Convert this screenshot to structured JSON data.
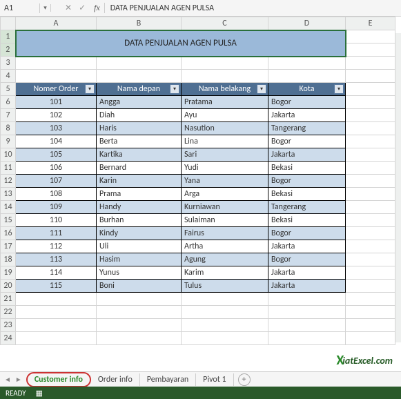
{
  "formula_bar": {
    "name_box": "A1",
    "cancel": "✕",
    "enter": "✓",
    "fx": "fx",
    "formula": "DATA PENJUALAN AGEN PULSA"
  },
  "columns": [
    "A",
    "B",
    "C",
    "D",
    "E"
  ],
  "row_numbers": [
    "1",
    "2",
    "3",
    "4",
    "5",
    "6",
    "7",
    "8",
    "9",
    "10",
    "11",
    "12",
    "13",
    "14",
    "15",
    "16",
    "17",
    "18",
    "19",
    "20",
    "21",
    "22",
    "23",
    "24"
  ],
  "title_cell": "DATA PENJUALAN AGEN PULSA",
  "chart_data": {
    "type": "table",
    "headers": [
      "Nomer Order",
      "Nama depan",
      "Nama belakang",
      "Kota"
    ],
    "rows": [
      [
        "101",
        "Angga",
        "Pratama",
        "Bogor"
      ],
      [
        "102",
        "Diah",
        "Ayu",
        "Jakarta"
      ],
      [
        "103",
        "Haris",
        "Nasution",
        "Tangerang"
      ],
      [
        "104",
        "Berta",
        "Lina",
        "Bogor"
      ],
      [
        "105",
        "Kartika",
        "Sari",
        "Jakarta"
      ],
      [
        "106",
        "Bernard",
        "Yudi",
        "Bekasi"
      ],
      [
        "107",
        "Karin",
        "Yana",
        "Bogor"
      ],
      [
        "108",
        "Prama",
        "Arga",
        "Bekasi"
      ],
      [
        "109",
        "Handy",
        "Kurniawan",
        "Tangerang"
      ],
      [
        "110",
        "Burhan",
        "Sulaiman",
        "Bekasi"
      ],
      [
        "111",
        "Kindy",
        "Fairus",
        "Bogor"
      ],
      [
        "112",
        "Uli",
        "Artha",
        "Jakarta"
      ],
      [
        "113",
        "Hasim",
        "Agung",
        "Bogor"
      ],
      [
        "114",
        "Yunus",
        "Karim",
        "Jakarta"
      ],
      [
        "115",
        "Boni",
        "Tulus",
        "Jakarta"
      ]
    ]
  },
  "sheet_tabs": {
    "active": "Customer info",
    "others": [
      "Order info",
      "Pembayaran",
      "Pivot 1"
    ],
    "add": "+"
  },
  "status": {
    "ready": "READY"
  },
  "brand": {
    "x": "X",
    "text": "iatExcel.com"
  },
  "icons": {
    "filter_arrow": "▾",
    "nav_left": "◄",
    "nav_right": "►"
  }
}
